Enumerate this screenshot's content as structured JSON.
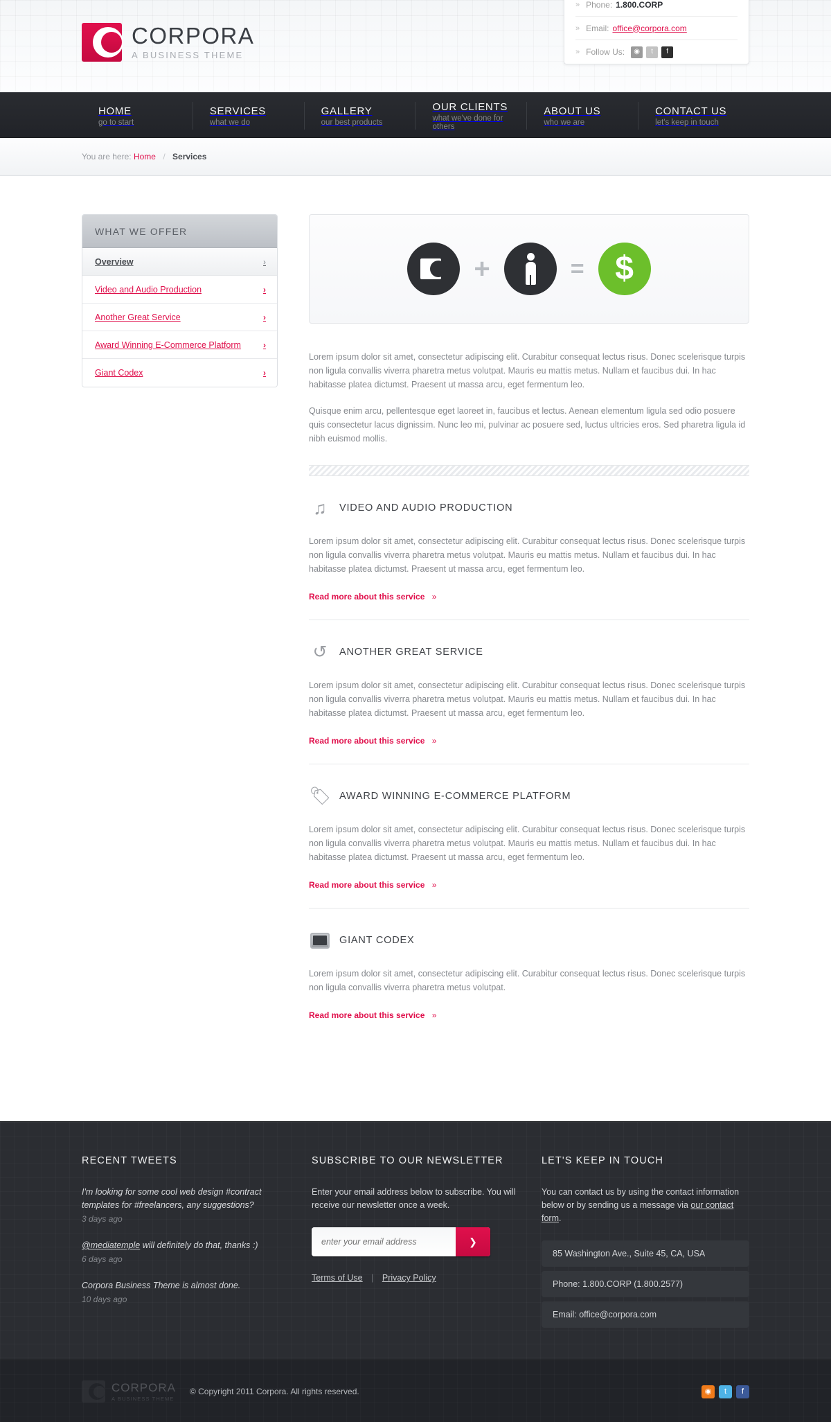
{
  "brand": {
    "name": "CORPORA",
    "tagline": "A BUSINESS THEME"
  },
  "header_contact": {
    "phone_label": "Phone:",
    "phone_value": "1.800.CORP",
    "email_label": "Email:",
    "email_value": "office@corpora.com",
    "follow_label": "Follow Us:",
    "social": [
      "rss-icon",
      "twitter-icon",
      "facebook-icon"
    ]
  },
  "nav": [
    {
      "title": "HOME",
      "sub": "go to start"
    },
    {
      "title": "SERVICES",
      "sub": "what we do"
    },
    {
      "title": "GALLERY",
      "sub": "our best products"
    },
    {
      "title": "OUR CLIENTS",
      "sub": "what we've done for others"
    },
    {
      "title": "ABOUT US",
      "sub": "who we are"
    },
    {
      "title": "CONTACT US",
      "sub": "let's keep in touch"
    }
  ],
  "breadcrumb": {
    "prefix": "You are here:",
    "home": "Home",
    "separator": "/",
    "current": "Services"
  },
  "sidebar": {
    "heading": "WHAT WE OFFER",
    "items": [
      {
        "label": "Overview",
        "active": true
      },
      {
        "label": "Video and Audio Production",
        "active": false
      },
      {
        "label": "Another Great Service",
        "active": false
      },
      {
        "label": "Award Winning E-Commerce Platform",
        "active": false
      },
      {
        "label": "Giant Codex",
        "active": false
      }
    ]
  },
  "hero": {
    "plus": "+",
    "equals": "=",
    "dollar": "$",
    "green": "#6cbf2b"
  },
  "intro": {
    "p1": "Lorem ipsum dolor sit amet, consectetur adipiscing elit. Curabitur consequat lectus risus. Donec scelerisque turpis non ligula convallis viverra pharetra metus volutpat. Mauris eu mattis metus. Nullam et faucibus dui. In hac habitasse platea dictumst. Praesent ut massa arcu, eget fermentum leo.",
    "p2": "Quisque enim arcu, pellentesque eget laoreet in, faucibus et lectus. Aenean elementum ligula sed odio posuere quis consectetur lacus dignissim. Nunc leo mi, pulvinar ac posuere sed, luctus ultricies eros. Sed pharetra ligula id nibh euismod mollis."
  },
  "services": [
    {
      "icon": "music-note-icon",
      "title": "VIDEO AND AUDIO PRODUCTION",
      "text": "Lorem ipsum dolor sit amet, consectetur adipiscing elit. Curabitur consequat lectus risus. Donec scelerisque turpis non ligula convallis viverra pharetra metus volutpat. Mauris eu mattis metus. Nullam et faucibus dui. In hac habitasse platea dictumst. Praesent ut massa arcu, eget fermentum leo.",
      "link": "Read more about this service",
      "link_chevron": "»"
    },
    {
      "icon": "sync-arrows-icon",
      "title": "ANOTHER GREAT SERVICE",
      "text": "Lorem ipsum dolor sit amet, consectetur adipiscing elit. Curabitur consequat lectus risus. Donec scelerisque turpis non ligula convallis viverra pharetra metus volutpat. Mauris eu mattis metus. Nullam et faucibus dui. In hac habitasse platea dictumst. Praesent ut massa arcu, eget fermentum leo.",
      "link": "Read more about this service",
      "link_chevron": "»"
    },
    {
      "icon": "price-tag-icon",
      "title": "AWARD WINNING E-COMMERCE PLATFORM",
      "text": "Lorem ipsum dolor sit amet, consectetur adipiscing elit. Curabitur consequat lectus risus. Donec scelerisque turpis non ligula convallis viverra pharetra metus volutpat. Mauris eu mattis metus. Nullam et faucibus dui. In hac habitasse platea dictumst. Praesent ut massa arcu, eget fermentum leo.",
      "link": "Read more about this service",
      "link_chevron": "»"
    },
    {
      "icon": "screen-icon",
      "title": "GIANT CODEX",
      "text": "Lorem ipsum dolor sit amet, consectetur adipiscing elit. Curabitur consequat lectus risus. Donec scelerisque turpis non ligula convallis viverra pharetra metus volutpat.",
      "link": "Read more about this service",
      "link_chevron": "»"
    }
  ],
  "footer": {
    "tweets": {
      "heading": "RECENT TWEETS",
      "items": [
        {
          "text": "I'm looking for some cool web design #contract templates for #freelancers, any suggestions?",
          "age": "3 days ago",
          "handle": ""
        },
        {
          "text": " will definitely do that, thanks :)",
          "age": "6 days ago",
          "handle": "@mediatemple"
        },
        {
          "text": "Corpora Business Theme is almost done.",
          "age": "10 days ago",
          "handle": ""
        }
      ]
    },
    "newsletter": {
      "heading": "SUBSCRIBE TO OUR NEWSLETTER",
      "lead": "Enter your email address below to subscribe. You will receive our newsletter once a week.",
      "placeholder": "enter your email address",
      "value": "",
      "submit": "❯",
      "terms": "Terms of Use",
      "divider": "|",
      "privacy": "Privacy Policy"
    },
    "touch": {
      "heading": "LET'S KEEP IN TOUCH",
      "lead_before": "You can contact us by using the contact information below or by sending us a message via ",
      "lead_link": "our contact form",
      "lead_after": ".",
      "boxes": [
        "85 Washington Ave., Suite 45, CA, USA",
        "Phone: 1.800.CORP (1.800.2577)",
        "Email: office@corpora.com"
      ]
    }
  },
  "bottom": {
    "copyright": "© Copyright 2011 Corpora. All rights reserved.",
    "social": [
      "rss-icon",
      "twitter-icon",
      "facebook-icon"
    ]
  }
}
